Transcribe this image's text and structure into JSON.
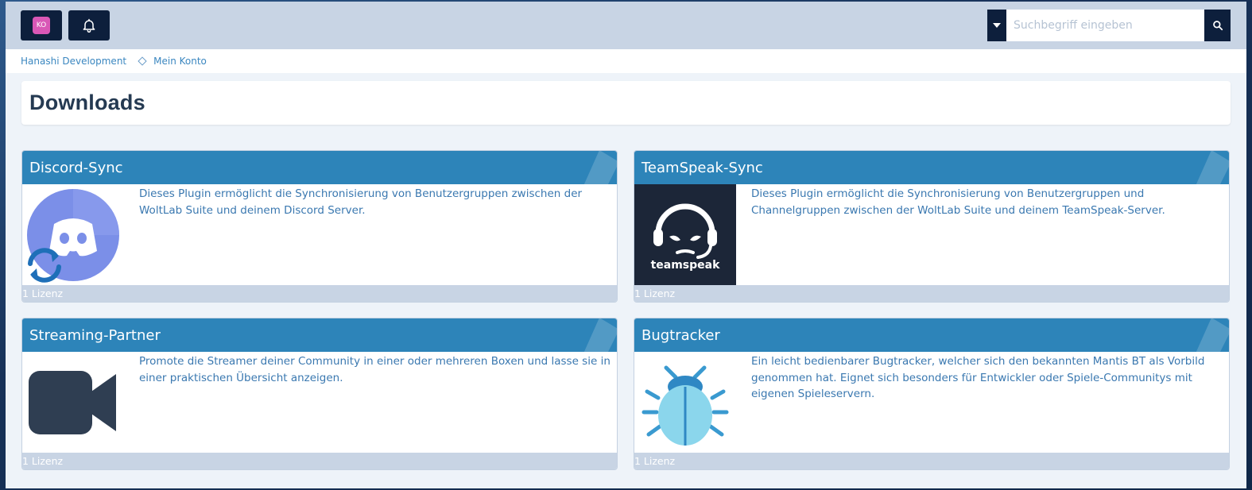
{
  "header": {
    "avatar_initials": "KO",
    "search_placeholder": "Suchbegriff eingeben"
  },
  "breadcrumb": {
    "items": [
      "Hanashi Development",
      "Mein Konto"
    ]
  },
  "page": {
    "title": "Downloads"
  },
  "colors": {
    "accent": "#2d84b9",
    "nav_dark": "#0d1f3c",
    "header_bg": "#c8d4e4",
    "link": "#3b87c0"
  },
  "cards": [
    {
      "title": "Discord-Sync",
      "icon": "discord-sync-icon",
      "description": "Dieses Plugin ermöglicht die Synchronisierung von Benutzergruppen zwischen der WoltLab Suite und deinem Discord Server.",
      "footer": "1 Lizenz"
    },
    {
      "title": "TeamSpeak-Sync",
      "icon": "teamspeak-logo-icon",
      "logo_text": "teamspeak",
      "description": "Dieses Plugin ermöglicht die Synchronisierung von Benutzergruppen und Channelgruppen zwischen der WoltLab Suite und deinem TeamSpeak-Server.",
      "footer": "1 Lizenz"
    },
    {
      "title": "Streaming-Partner",
      "icon": "video-camera-icon",
      "description": "Promote die Streamer deiner Community in einer oder mehreren Boxen und lasse sie in einer praktischen Übersicht anzeigen.",
      "footer": "1 Lizenz"
    },
    {
      "title": "Bugtracker",
      "icon": "bug-icon",
      "description": "Ein leicht bedienbarer Bugtracker, welcher sich den bekannten Mantis BT als Vorbild genommen hat. Eignet sich besonders für Entwickler oder Spiele-Communitys mit eigenen Spieleservern.",
      "footer": "1 Lizenz"
    }
  ]
}
